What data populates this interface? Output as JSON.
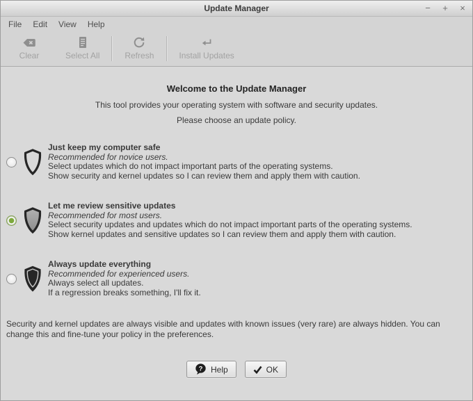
{
  "window": {
    "title": "Update Manager",
    "controls": {
      "minimize": "−",
      "maximize": "+",
      "close": "×"
    }
  },
  "menubar": {
    "items": [
      {
        "label": "File"
      },
      {
        "label": "Edit"
      },
      {
        "label": "View"
      },
      {
        "label": "Help"
      }
    ]
  },
  "toolbar": {
    "buttons": [
      {
        "label": "Clear",
        "icon": "clear-tag-icon",
        "enabled": false
      },
      {
        "label": "Select All",
        "icon": "select-all-document-icon",
        "enabled": false
      },
      {
        "label": "Refresh",
        "icon": "refresh-icon",
        "enabled": false
      },
      {
        "label": "Install Updates",
        "icon": "install-return-arrow-icon",
        "enabled": false
      }
    ]
  },
  "welcome": {
    "title": "Welcome to the Update Manager",
    "subtitle": "This tool provides your operating system with software and security updates.",
    "prompt": "Please choose an update policy."
  },
  "policies": [
    {
      "title": "Just keep my computer safe",
      "recommendation": "Recommended for novice users.",
      "lines": [
        "Select updates which do not impact important parts of the operating systems.",
        "Show security and kernel updates so I can review them and apply them with caution."
      ],
      "selected": false,
      "shield": "outline"
    },
    {
      "title": "Let me review sensitive updates",
      "recommendation": "Recommended for most users.",
      "lines": [
        "Select security updates and updates which do not impact important parts of the operating systems.",
        "Show kernel updates and sensitive updates so I can review them and apply them with caution."
      ],
      "selected": true,
      "shield": "gray"
    },
    {
      "title": "Always update everything",
      "recommendation": "Recommended for experienced users.",
      "lines": [
        "Always select all updates.",
        "If a regression breaks something, I'll fix it."
      ],
      "selected": false,
      "shield": "black"
    }
  ],
  "footnote": "Security and kernel updates are always visible and updates with known issues (very rare) are always hidden. You can change this and fine-tune your policy in the preferences.",
  "actions": {
    "help_label": "Help",
    "ok_label": "OK"
  },
  "colors": {
    "radio_selected_green": "#7da93c",
    "chrome_bg": "#d4d4d4",
    "content_bg": "#d9d9d9"
  }
}
